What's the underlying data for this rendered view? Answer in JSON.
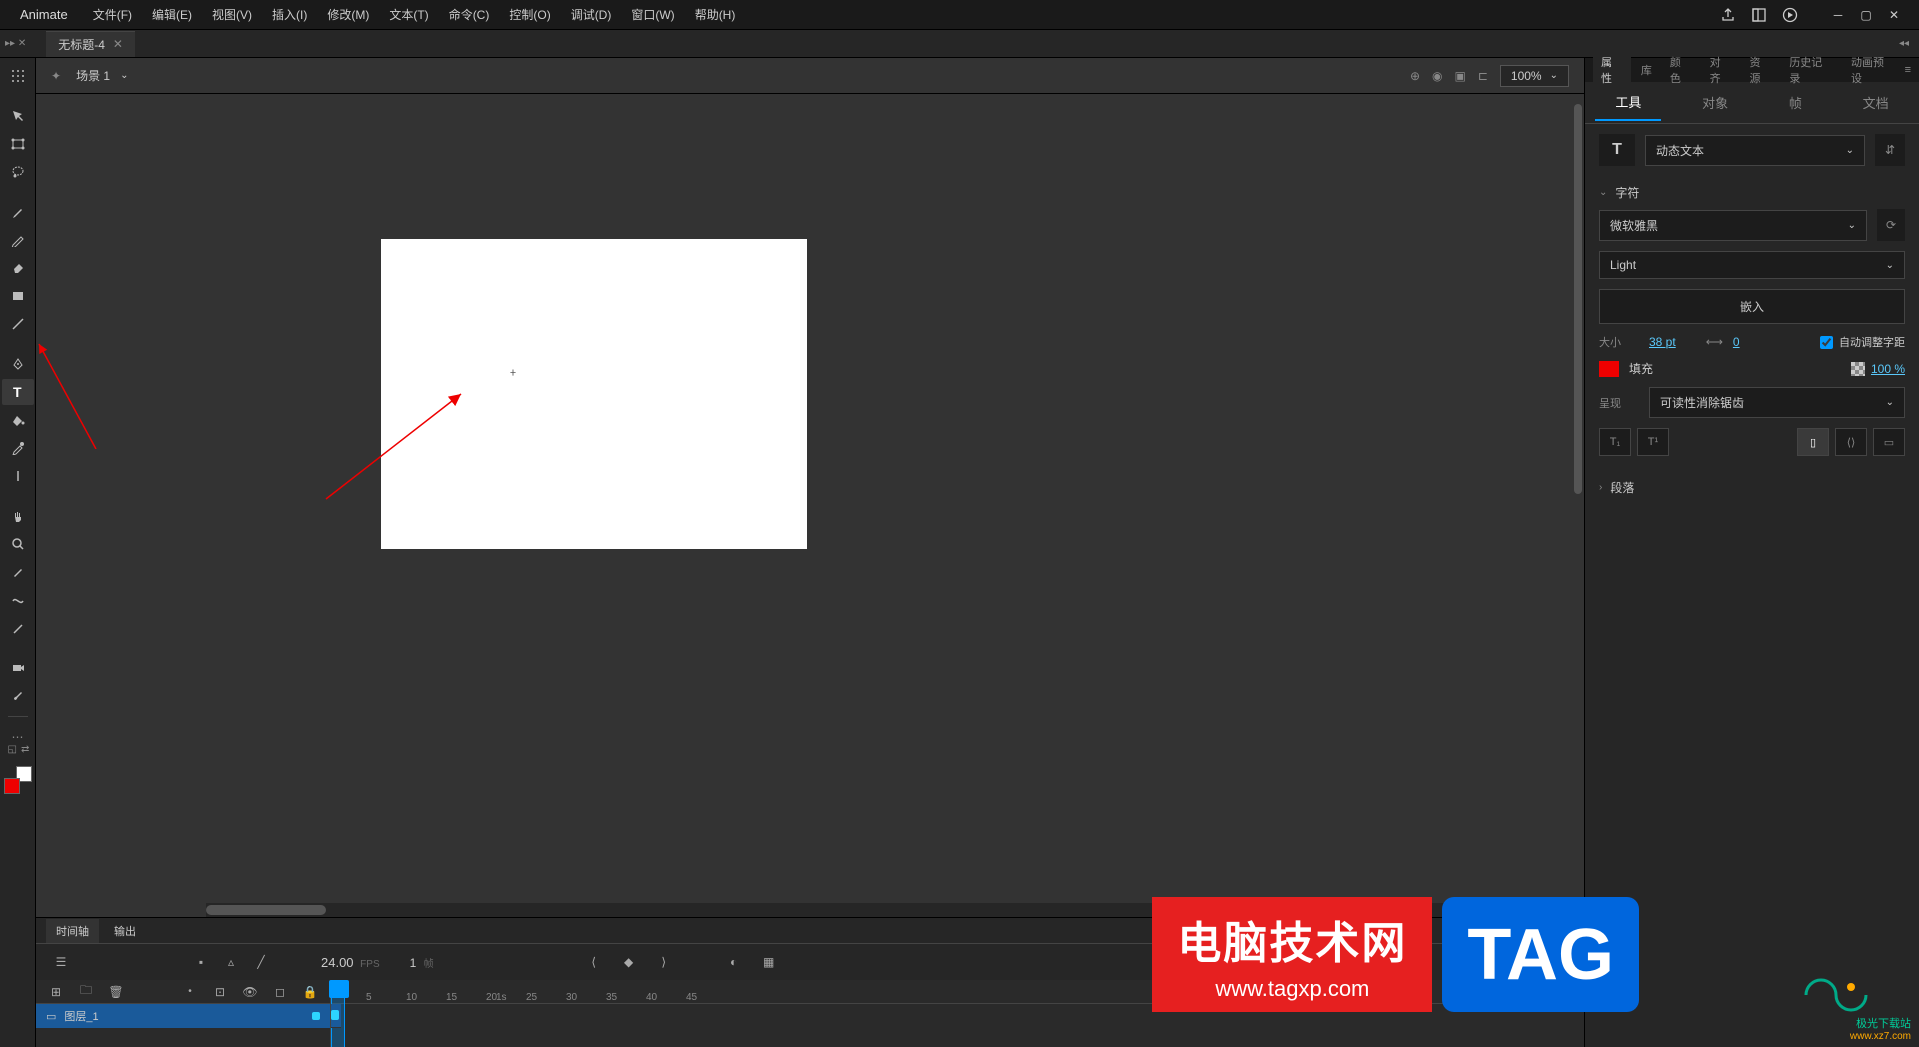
{
  "app": {
    "name": "Animate"
  },
  "menu": {
    "file": "文件(F)",
    "edit": "编辑(E)",
    "view": "视图(V)",
    "insert": "插入(I)",
    "modify": "修改(M)",
    "text": "文本(T)",
    "command": "命令(C)",
    "control": "控制(O)",
    "debug": "调试(D)",
    "window": "窗口(W)",
    "help": "帮助(H)"
  },
  "document": {
    "tab_title": "无标题-4",
    "scene": "场景 1",
    "zoom": "100%"
  },
  "timeline": {
    "tab_timeline": "时间轴",
    "tab_output": "输出",
    "fps": "24.00",
    "fps_label": "FPS",
    "frame": "1",
    "frame_label": "帧",
    "ruler_marks": [
      "1s",
      "5",
      "10",
      "15",
      "20",
      "25",
      "30",
      "35",
      "40",
      "45"
    ],
    "layer1": "图层_1"
  },
  "panels": {
    "tabs": {
      "properties": "属性",
      "library": "库",
      "color": "颜色",
      "align": "对齐",
      "assets": "资源",
      "history": "历史记录",
      "animation": "动画预设"
    },
    "prop_tabs": {
      "tool": "工具",
      "object": "对象",
      "frame": "帧",
      "document": "文档"
    },
    "text_type": "动态文本",
    "char_section": "字符",
    "font_family": "微软雅黑",
    "font_style": "Light",
    "embed_btn": "嵌入",
    "size_label": "大小",
    "size_value": "38 pt",
    "spacing_value": "0",
    "auto_kern": "自动调整字距",
    "fill_label": "填充",
    "opacity": "100 %",
    "render_label": "呈现",
    "render_value": "可读性消除锯齿",
    "para_section": "段落"
  },
  "watermark": {
    "title": "电脑技术网",
    "url": "www.tagxp.com",
    "tag": "TAG",
    "corner_top": "极光下载站",
    "corner_bottom": "www.xz7.com"
  }
}
